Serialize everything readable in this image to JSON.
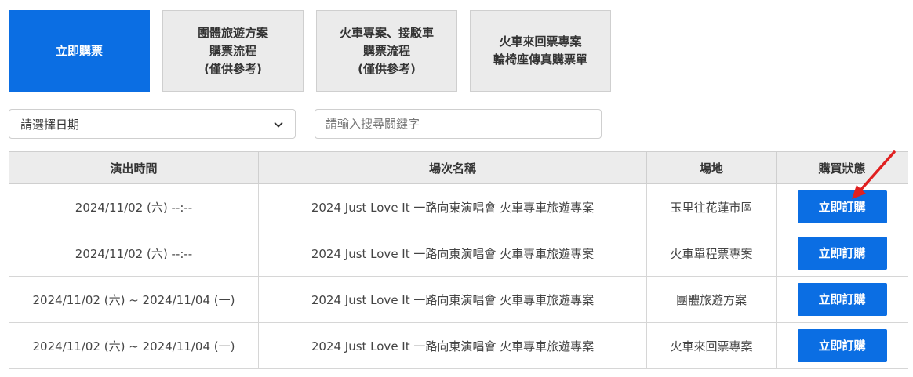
{
  "top_buttons": {
    "buy_now": "立即購票",
    "group_tour": [
      "團體旅遊方案",
      "購票流程",
      "(僅供參考)"
    ],
    "train_shuttle": [
      "火車專案、接駁車",
      "購票流程",
      "(僅供參考)"
    ],
    "round_trip": [
      "火車來回票專案",
      "輪椅座傳真購票單"
    ]
  },
  "filters": {
    "date_select_label": "請選擇日期",
    "search_placeholder": "請輸入搜尋關鍵字"
  },
  "table": {
    "headers": [
      "演出時間",
      "場次名稱",
      "場地",
      "購買狀態"
    ],
    "rows": [
      {
        "time": "2024/11/02 (六) --:--",
        "name": "2024 Just Love It 一路向東演唱會 火車專車旅遊專案",
        "venue": "玉里往花蓮市區",
        "action": "立即訂購"
      },
      {
        "time": "2024/11/02 (六) --:--",
        "name": "2024 Just Love It 一路向東演唱會 火車專車旅遊專案",
        "venue": "火車單程票專案",
        "action": "立即訂購"
      },
      {
        "time": "2024/11/02 (六) ~ 2024/11/04 (一)",
        "name": "2024 Just Love It 一路向東演唱會 火車專車旅遊專案",
        "venue": "團體旅遊方案",
        "action": "立即訂購"
      },
      {
        "time": "2024/11/02 (六) ~ 2024/11/04 (一)",
        "name": "2024 Just Love It 一路向東演唱會 火車專車旅遊專案",
        "venue": "火車來回票專案",
        "action": "立即訂購"
      }
    ]
  },
  "colors": {
    "primary": "#0b6ee3",
    "annotation_arrow": "#e02020"
  }
}
